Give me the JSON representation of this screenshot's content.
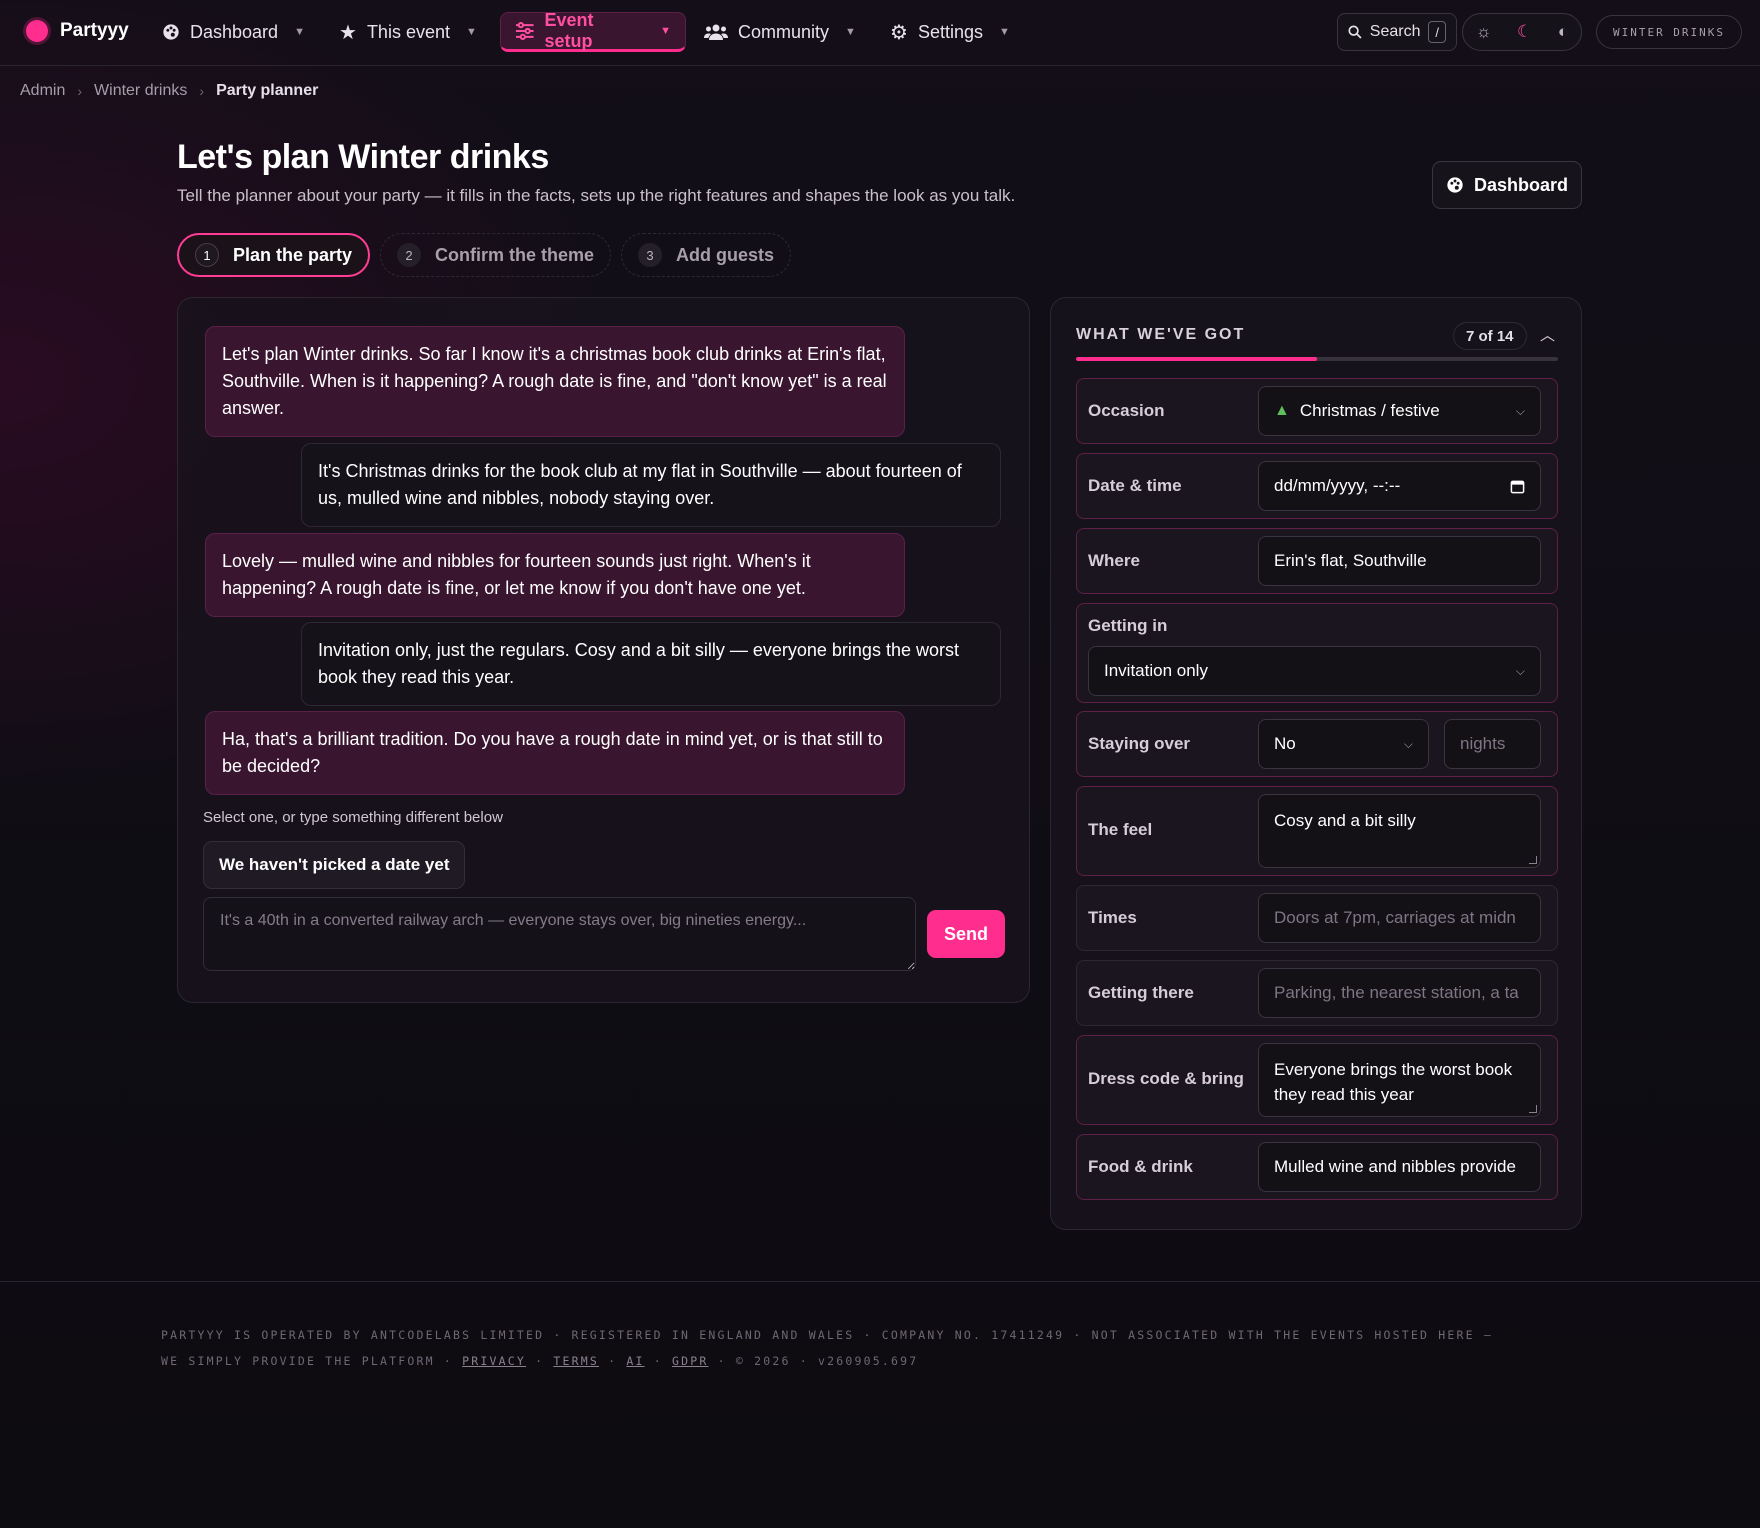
{
  "nav": {
    "brand": "Partyyy",
    "items": [
      {
        "label": "Dashboard",
        "icon": "palette-icon"
      },
      {
        "label": "This event",
        "icon": "star-icon"
      },
      {
        "label": "Event setup",
        "icon": "sliders-icon",
        "active": true
      },
      {
        "label": "Community",
        "icon": "users-icon"
      },
      {
        "label": "Settings",
        "icon": "gear-icon"
      }
    ],
    "search_label": "Search",
    "search_shortcut": "/",
    "event_chip": "WINTER DRINKS"
  },
  "breadcrumb": [
    "Admin",
    "Winter drinks",
    "Party planner"
  ],
  "header": {
    "title": "Let's plan Winter drinks",
    "subtitle": "Tell the planner about your party — it fills in the facts, sets up the right features and shapes the look as you talk.",
    "dashboard_button": "Dashboard"
  },
  "steps": [
    {
      "num": "1",
      "label": "Plan the party",
      "active": true
    },
    {
      "num": "2",
      "label": "Confirm the theme"
    },
    {
      "num": "3",
      "label": "Add guests"
    }
  ],
  "chat": {
    "messages": [
      {
        "role": "bot",
        "text": "Let's plan Winter drinks. So far I know it's a christmas book club drinks at Erin's flat, Southville. When is it happening? A rough date is fine, and \"don't know yet\" is a real answer."
      },
      {
        "role": "user",
        "text": "It's Christmas drinks for the book club at my flat in Southville — about fourteen of us, mulled wine and nibbles, nobody staying over."
      },
      {
        "role": "bot",
        "text": "Lovely — mulled wine and nibbles for fourteen sounds just right. When's it happening? A rough date is fine, or let me know if you don't have one yet."
      },
      {
        "role": "user",
        "text": "Invitation only, just the regulars. Cosy and a bit silly — everyone brings the worst book they read this year."
      },
      {
        "role": "bot",
        "text": "Ha, that's a brilliant tradition. Do you have a rough date in mind yet, or is that still to be decided?"
      }
    ],
    "hint": "Select one, or type something different below",
    "suggestion": "We haven't picked a date yet",
    "input_placeholder": "It's a 40th in a converted railway arch — everyone stays over, big nineties energy...",
    "send_label": "Send"
  },
  "facts": {
    "title": "WHAT WE'VE GOT",
    "count": "7 of 14",
    "progress": 0.5,
    "rows": [
      {
        "label": "Occasion",
        "value": "Christmas / festive",
        "icon": "tree-icon"
      },
      {
        "label": "Date & time",
        "value": "dd/mm/yyyy, --:--"
      },
      {
        "label": "Where",
        "value": "Erin's flat, Southville"
      },
      {
        "label": "Getting in",
        "value": "Invitation only"
      },
      {
        "label": "Staying over",
        "value": "No",
        "nights_placeholder": "nights"
      },
      {
        "label": "The feel",
        "value": "Cosy and a bit silly"
      },
      {
        "label": "Times",
        "placeholder": "Doors at 7pm, carriages at midn"
      },
      {
        "label": "Getting there",
        "placeholder": "Parking, the nearest station, a ta"
      },
      {
        "label": "Dress code & bring",
        "value": "Everyone brings the worst book they read this year"
      },
      {
        "label": "Food & drink",
        "value": "Mulled wine and nibbles provide"
      }
    ]
  },
  "footer": {
    "line1": "PARTYYY IS OPERATED BY ANTCODELABS LIMITED · REGISTERED IN ENGLAND AND WALES · COMPANY NO. 17411249 · NOT ASSOCIATED WITH THE EVENTS HOSTED HERE —",
    "line2_start": "WE SIMPLY PROVIDE THE PLATFORM ·",
    "links": [
      "PRIVACY",
      "TERMS",
      "AI",
      "GDPR"
    ],
    "line2_end": "· © 2026 · v260905.697"
  },
  "colors": {
    "accent": "#ff2d8e",
    "bot_bubble": "#3a1530",
    "background": "#130e18"
  }
}
